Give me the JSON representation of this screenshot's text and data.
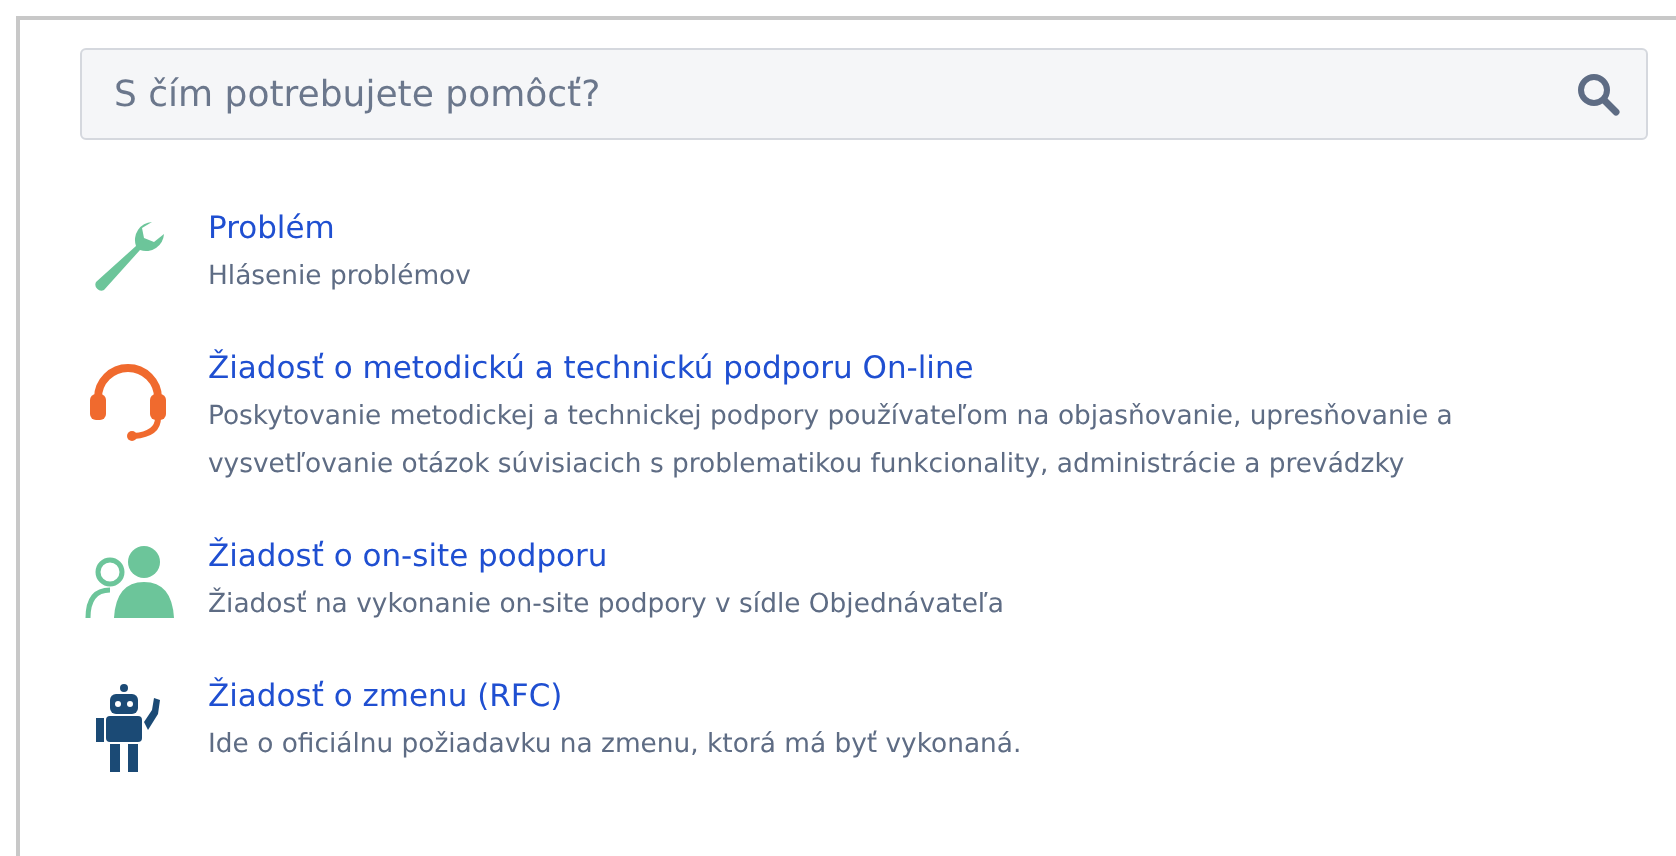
{
  "search": {
    "placeholder": "S čím potrebujete pomôcť?"
  },
  "request_types": [
    {
      "kind": "wrench",
      "title": "Problém",
      "description": "Hlásenie problémov"
    },
    {
      "kind": "headset",
      "title": "Žiadosť o metodickú a technickú podporu On-line",
      "description": "Poskytovanie metodickej a technickej podpory používateľom na objasňovanie, upresňovanie a vysvetľovanie otázok súvisiacich s problematikou funkcionality, administrácie a prevádzky"
    },
    {
      "kind": "people",
      "title": "Žiadosť o on-site podporu",
      "description": "Žiadosť na vykonanie on-site podpory v sídle Objednávateľa"
    },
    {
      "kind": "robot",
      "title": "Žiadosť o zmenu (RFC)",
      "description": "Ide o oficiálnu požiadavku na zmenu, ktorá má byť vykonaná."
    }
  ]
}
